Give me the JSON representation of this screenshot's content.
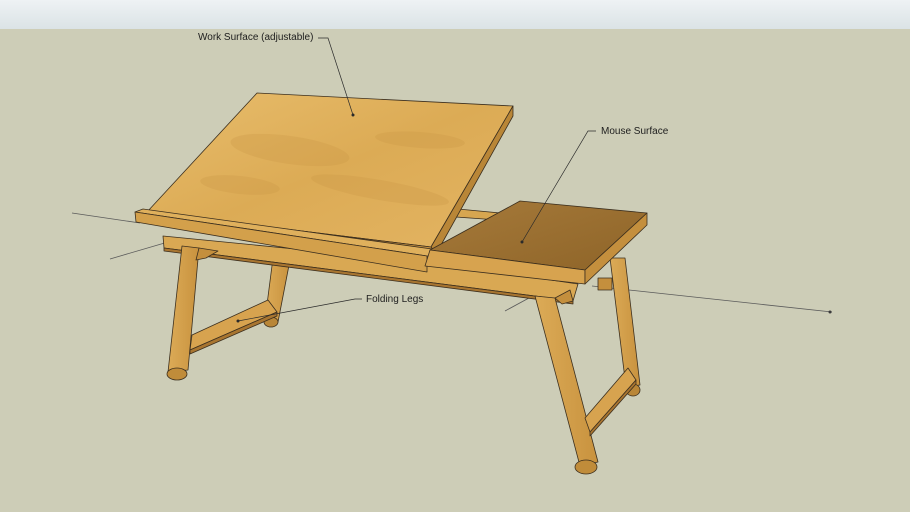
{
  "callouts": {
    "work_surface": "Work Surface (adjustable)",
    "mouse_surface": "Mouse Surface",
    "folding_legs": "Folding Legs"
  },
  "colors": {
    "sky": "#e6ecee",
    "ground": "#cdcdb7",
    "wood_light": "#e6b968",
    "wood_mid": "#d6a44e",
    "wood_dark": "#b68436",
    "mouse_top": "#9a6e32",
    "edge": "#3c2f1e"
  }
}
